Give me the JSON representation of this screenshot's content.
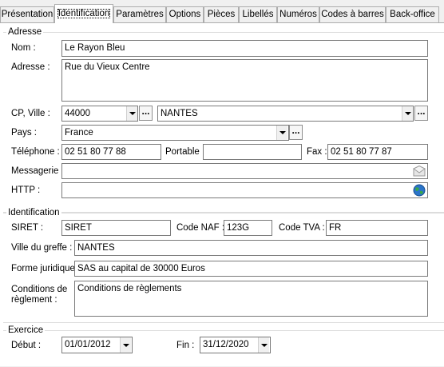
{
  "tabs": [
    {
      "label": "Présentation"
    },
    {
      "label": "Identification"
    },
    {
      "label": "Paramètres"
    },
    {
      "label": "Options"
    },
    {
      "label": "Pièces"
    },
    {
      "label": "Libellés"
    },
    {
      "label": "Numéros"
    },
    {
      "label": "Codes à barres"
    },
    {
      "label": "Back-office"
    }
  ],
  "adresse": {
    "legend": "Adresse",
    "nom_label": "Nom :",
    "nom_value": "Le Rayon Bleu",
    "adresse_label": "Adresse :",
    "adresse_value": "Rue du Vieux Centre",
    "cpville_label": "CP, Ville :",
    "cp_value": "44000",
    "ville_value": "NANTES",
    "pays_label": "Pays :",
    "pays_value": "France",
    "telephone_label": "Téléphone :",
    "telephone_value": "02 51 80 77 88",
    "portable_label": "Portable :",
    "portable_value": "",
    "fax_label": "Fax :",
    "fax_value": "02 51 80 77 87",
    "messagerie_label": "Messagerie :",
    "messagerie_value": "",
    "http_label": "HTTP :",
    "http_value": "",
    "dots_label": "..."
  },
  "identification": {
    "legend": "Identification",
    "siret_label": "SIRET :",
    "siret_value": "SIRET",
    "naf_label": "Code NAF :",
    "naf_value": "123G",
    "tva_label": "Code TVA :",
    "tva_value": "FR",
    "greffe_label": "Ville du greffe :",
    "greffe_value": "NANTES",
    "forme_label": "Forme juridique :",
    "forme_value": "SAS au capital de 30000 Euros",
    "conditions_label_1": "Conditions de",
    "conditions_label_2": "règlement :",
    "conditions_value": "Conditions de règlements"
  },
  "exercice": {
    "legend": "Exercice",
    "debut_label": "Début :",
    "debut_value": "01/01/2012",
    "fin_label": "Fin :",
    "fin_value": "31/12/2020"
  },
  "icons": {
    "messagerie": "envelope-icon",
    "http": "globe-icon"
  },
  "colors": {
    "globe_blue": "#2a74c9",
    "globe_green": "#3aa64a"
  }
}
